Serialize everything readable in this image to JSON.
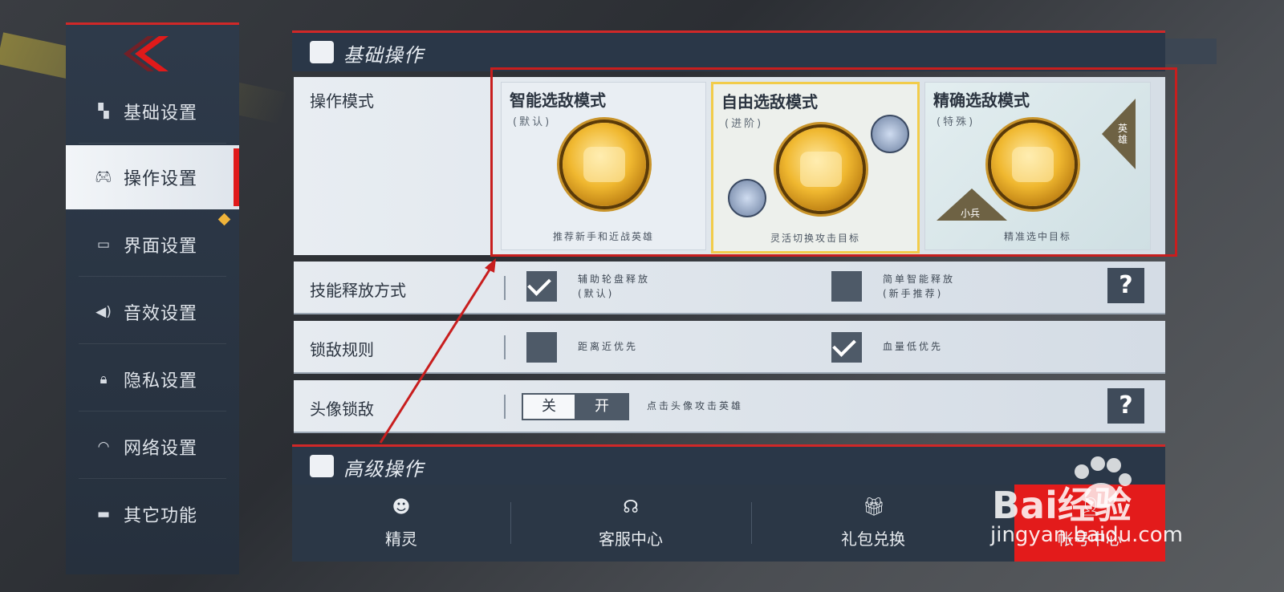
{
  "sidebar": {
    "items": [
      {
        "label": "基础设置",
        "icon": "layout-grid-icon"
      },
      {
        "label": "操作设置",
        "icon": "gamepad-icon"
      },
      {
        "label": "界面设置",
        "icon": "screen-icon"
      },
      {
        "label": "音效设置",
        "icon": "speaker-icon"
      },
      {
        "label": "隐私设置",
        "icon": "lock-icon"
      },
      {
        "label": "网络设置",
        "icon": "wifi-icon"
      },
      {
        "label": "其它功能",
        "icon": "folder-icon"
      }
    ],
    "active_index": 1
  },
  "basic_section": {
    "title": "基础操作"
  },
  "advanced_section": {
    "title": "高级操作"
  },
  "operation_mode": {
    "label": "操作模式",
    "modes": [
      {
        "title": "智能选敌模式",
        "sub": "(默认)",
        "caption": "推荐新手和近战英雄"
      },
      {
        "title": "自由选敌模式",
        "sub": "(进阶)",
        "caption": "灵活切换攻击目标",
        "selected": true
      },
      {
        "title": "精确选敌模式",
        "sub": "(特殊)",
        "caption": "精准选中目标",
        "tag_hero": "英雄",
        "tag_minion": "小兵"
      }
    ]
  },
  "skill_release": {
    "label": "技能释放方式",
    "opt1": {
      "text": "辅助轮盘释放",
      "sub": "(默认)",
      "checked": true
    },
    "opt2": {
      "text": "简单智能释放",
      "sub": "(新手推荐)",
      "checked": false
    },
    "help": "?"
  },
  "lock_rule": {
    "label": "锁敌规则",
    "opt1": {
      "text": "距离近优先",
      "checked": false
    },
    "opt2": {
      "text": "血量低优先",
      "checked": true
    }
  },
  "avatar_lock": {
    "label": "头像锁敌",
    "toggle_off": "关",
    "toggle_on": "开",
    "hint": "点击头像攻击英雄",
    "help": "?"
  },
  "bottom_bar": {
    "items": [
      {
        "label": "精灵",
        "icon": "sprite-icon"
      },
      {
        "label": "客服中心",
        "icon": "headset-icon"
      },
      {
        "label": "礼包兑换",
        "icon": "gift-icon"
      },
      {
        "label": "帐号中心",
        "icon": "account-icon"
      }
    ]
  },
  "watermark": {
    "brand": "Bai经验",
    "url": "jingyan.baidu.com"
  },
  "colors": {
    "accent_red": "#d02828",
    "selected_gold": "#f2cc4a",
    "panel_dark": "#2a3748"
  }
}
